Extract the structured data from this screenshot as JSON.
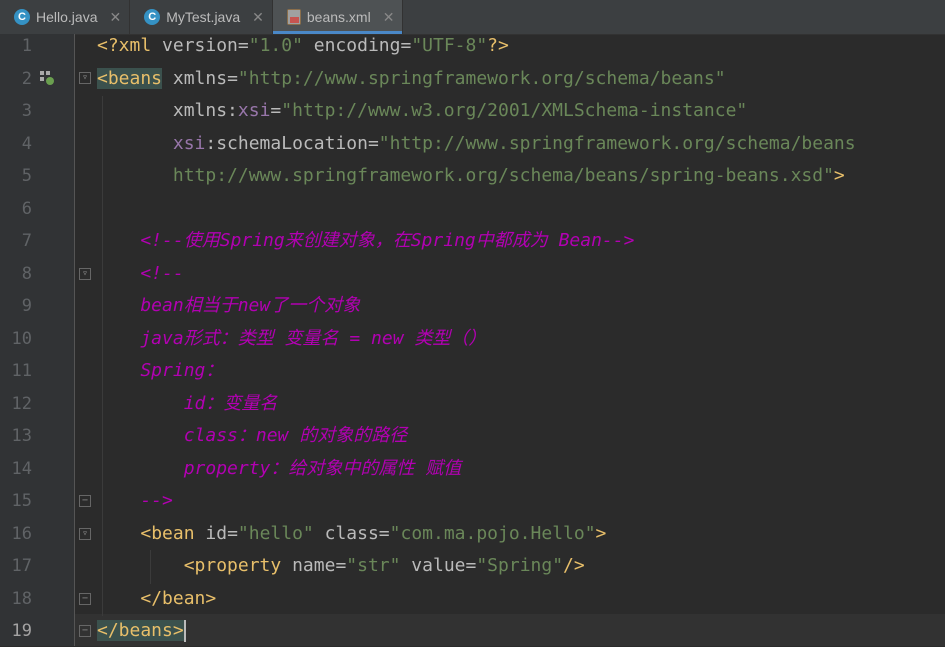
{
  "tabs": [
    {
      "label": "Hello.java",
      "icon": "java-class-icon",
      "active": false
    },
    {
      "label": "MyTest.java",
      "icon": "java-class-icon",
      "active": false
    },
    {
      "label": "beans.xml",
      "icon": "xml-file-icon",
      "active": true
    }
  ],
  "colors": {
    "background": "#2b2b2b",
    "tag": "#e8bf6a",
    "attribute": "#bababa",
    "namespace": "#9876aa",
    "value": "#6a8759",
    "comment": "#b200b2",
    "tab_accent": "#4a88c7"
  },
  "editor": {
    "current_line": 19,
    "line_numbers": [
      "1",
      "2",
      "3",
      "4",
      "5",
      "6",
      "7",
      "8",
      "9",
      "10",
      "11",
      "12",
      "13",
      "14",
      "15",
      "16",
      "17",
      "18",
      "19"
    ],
    "lines": {
      "l1": {
        "decl_open": "<?xml ",
        "a1": "version",
        "eq1": "=",
        "v1": "\"1.0\"",
        "a2": " encoding",
        "eq2": "=",
        "v2": "\"UTF-8\"",
        "decl_close": "?>"
      },
      "l2": {
        "tag": "<beans",
        "a1": " xmlns",
        "eq": "=",
        "v1": "\"http://www.springframework.org/schema/beans\""
      },
      "l3": {
        "indent": "       ",
        "a1": "xmlns:",
        "ns": "xsi",
        "eq": "=",
        "v1": "\"http://www.w3.org/2001/XMLSchema-instance\""
      },
      "l4": {
        "indent": "       ",
        "ns": "xsi",
        "a1": ":schemaLocation",
        "eq": "=",
        "v1": "\"http://www.springframework.org/schema/beans"
      },
      "l5": {
        "indent": "       ",
        "v1": "http://www.springframework.org/schema/beans/spring-beans.xsd\"",
        "close": ">"
      },
      "l7": {
        "text": "    <!--使用Spring来创建对象，在Spring中都成为 Bean-->"
      },
      "l8": {
        "text": "    <!--"
      },
      "l9": {
        "text": "    bean相当于new了一个对象"
      },
      "l10": {
        "text": "    java形式：类型 变量名 = new 类型（）"
      },
      "l11": {
        "text": "    Spring："
      },
      "l12": {
        "text": "        id：变量名"
      },
      "l13": {
        "text": "        class：new 的对象的路径"
      },
      "l14": {
        "text": "        property：给对象中的属性 赋值"
      },
      "l15": {
        "text": "    -->"
      },
      "l16": {
        "indent": "    ",
        "tag": "<bean",
        "a1": " id",
        "eq1": "=",
        "v1": "\"hello\"",
        "a2": " class",
        "eq2": "=",
        "v2": "\"com.ma.pojo.Hello\"",
        "close": ">"
      },
      "l17": {
        "indent": "        ",
        "tag": "<property",
        "a1": " name",
        "eq1": "=",
        "v1": "\"str\"",
        "a2": " value",
        "eq2": "=",
        "v2": "\"Spring\"",
        "close": "/>"
      },
      "l18": {
        "indent": "    ",
        "tag": "</bean>"
      },
      "l19": {
        "tag": "</beans>"
      }
    }
  }
}
